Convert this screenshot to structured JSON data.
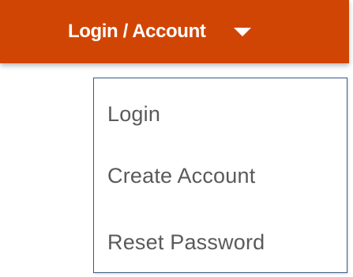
{
  "header": {
    "account_menu_label": "Login / Account",
    "caret_icon": "caret-down-icon",
    "bar_color": "#d14504"
  },
  "dropdown": {
    "items": [
      {
        "label": "Login"
      },
      {
        "label": "Create Account"
      },
      {
        "label": "Reset Password"
      }
    ],
    "border_color": "#3c5a8a",
    "text_color": "#5a5a5a"
  }
}
